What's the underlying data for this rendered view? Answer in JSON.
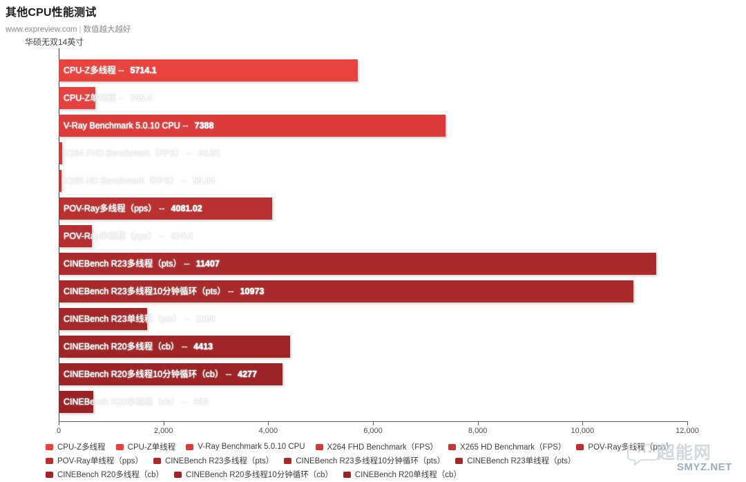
{
  "header": {
    "title": "其他CPU性能测试",
    "site": "www.expreview.com",
    "separator": "|",
    "note": "数值越大越好"
  },
  "series_name": "华硕无双14英寸",
  "watermark": {
    "cn": "超能网",
    "net": "SMYZ.NET",
    "logo_icon": "speech-bubble-icon"
  },
  "chart_data": {
    "type": "bar",
    "orientation": "horizontal",
    "title": "其他CPU性能测试",
    "subtitle": "www.expreview.com | 数值越大越好",
    "xlabel": "",
    "ylabel": "",
    "xlim": [
      0,
      12000
    ],
    "xticks": [
      0,
      2000,
      4000,
      6000,
      8000,
      10000,
      12000
    ],
    "xtick_labels": [
      "0",
      "2,000",
      "4,000",
      "6,000",
      "8,000",
      "10,000",
      "12,000"
    ],
    "grid": false,
    "legend_position": "bottom",
    "series_label": "华硕无双14英寸",
    "categories": [
      "CPU-Z多线程",
      "CPU-Z单线程",
      "V-Ray Benchmark 5.0.10 CPU",
      "X264 FHD Benchmark（FPS）",
      "X265 HD Benchmark（FPS）",
      "POV-Ray多线程（pps）",
      "POV-Ray单线程（pps）",
      "CINEBench R23多线程（pts）",
      "CINEBench R23多线程10分钟循环（pts）",
      "CINEBench R23单线程（pts）",
      "CINEBench R20多线程（cb）",
      "CINEBench R20多线程10分钟循环（cb）",
      "CINEBench R20单线程（cb）"
    ],
    "values": [
      5714.1,
      705.4,
      7388,
      66.91,
      55.04,
      4081.02,
      634.6,
      11407,
      10973,
      1689,
      4413,
      4277,
      659
    ],
    "value_labels": [
      "5714.1",
      "705.4",
      "7388",
      "66.91",
      "55.04",
      "4081.02",
      "634.6",
      "11407",
      "10973",
      "1689",
      "4413",
      "4277",
      "659"
    ],
    "colors": [
      "#e8433f",
      "#e5413e",
      "#db3c3a",
      "#d43936",
      "#c83633",
      "#b9302f",
      "#b52f30",
      "#ab2b2c",
      "#a82a2b",
      "#a42829",
      "#a02527",
      "#9d2426",
      "#992225"
    ],
    "bars": [
      {
        "label": "CPU-Z多线程",
        "dash": "--",
        "value_label": "5714.1",
        "value": 5714.1,
        "color": "#e8433f"
      },
      {
        "label": "CPU-Z单线程",
        "dash": "--",
        "value_label": "705.4",
        "value": 705.4,
        "color": "#e5413e"
      },
      {
        "label": "V-Ray Benchmark 5.0.10 CPU",
        "dash": "--",
        "value_label": "7388",
        "value": 7388,
        "color": "#db3c3a"
      },
      {
        "label": "X264 FHD Benchmark（FPS）",
        "dash": "--",
        "value_label": "66.91",
        "value": 66.91,
        "color": "#d43936"
      },
      {
        "label": "X265 HD Benchmark（FPS）",
        "dash": "--",
        "value_label": "55.04",
        "value": 55.04,
        "color": "#c83633"
      },
      {
        "label": "POV-Ray多线程（pps）",
        "dash": "--",
        "value_label": "4081.02",
        "value": 4081.02,
        "color": "#b9302f"
      },
      {
        "label": "POV-Ray单线程（pps）",
        "dash": "--",
        "value_label": "634.6",
        "value": 634.6,
        "color": "#b52f30"
      },
      {
        "label": "CINEBench R23多线程（pts）",
        "dash": "--",
        "value_label": "11407",
        "value": 11407,
        "color": "#ab2b2c"
      },
      {
        "label": "CINEBench R23多线程10分钟循环（pts）",
        "dash": "--",
        "value_label": "10973",
        "value": 10973,
        "color": "#a82a2b"
      },
      {
        "label": "CINEBench R23单线程（pts）",
        "dash": "--",
        "value_label": "1689",
        "value": 1689,
        "color": "#a42829"
      },
      {
        "label": "CINEBench R20多线程（cb）",
        "dash": "--",
        "value_label": "4413",
        "value": 4413,
        "color": "#a02527"
      },
      {
        "label": "CINEBench R20多线程10分钟循环（cb）",
        "dash": "--",
        "value_label": "4277",
        "value": 4277,
        "color": "#9d2426"
      },
      {
        "label": "CINEBench R20单线程（cb）",
        "dash": "--",
        "value_label": "659",
        "value": 659,
        "color": "#992225"
      }
    ],
    "legend": [
      {
        "label": "CPU-Z多线程",
        "color": "#e8433f"
      },
      {
        "label": "CPU-Z单线程",
        "color": "#e5413e"
      },
      {
        "label": "V-Ray Benchmark 5.0.10 CPU",
        "color": "#db3c3a"
      },
      {
        "label": "X264 FHD Benchmark（FPS）",
        "color": "#d43936"
      },
      {
        "label": "X265 HD Benchmark（FPS）",
        "color": "#c83633"
      },
      {
        "label": "POV-Ray多线程（pps）",
        "color": "#b9302f"
      },
      {
        "label": "POV-Ray单线程（pps）",
        "color": "#b52f30"
      },
      {
        "label": "CINEBench R23多线程（pts）",
        "color": "#ab2b2c"
      },
      {
        "label": "CINEBench R23多线程10分钟循环（pts）",
        "color": "#a82a2b"
      },
      {
        "label": "CINEBench R23单线程（pts）",
        "color": "#a42829"
      },
      {
        "label": "CINEBench R20多线程（cb）",
        "color": "#a02527"
      },
      {
        "label": "CINEBench R20多线程10分钟循环（cb）",
        "color": "#9d2426"
      },
      {
        "label": "CINEBench R20单线程（cb）",
        "color": "#992225"
      }
    ],
    "legend_rows": [
      [
        0,
        1,
        2,
        3,
        4,
        5
      ],
      [
        6,
        7,
        8,
        9
      ],
      [
        10,
        11,
        12
      ]
    ]
  }
}
